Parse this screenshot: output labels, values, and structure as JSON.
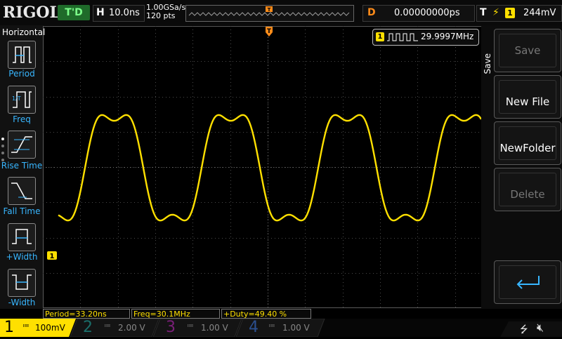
{
  "header": {
    "logo": "RIGOL",
    "run_status": "T'D",
    "timebase_key": "H",
    "timebase_value": "10.0ns",
    "sample_rate": "1.00GSa/s",
    "memory_depth": "120 pts",
    "delay_key": "D",
    "delay_value": "0.00000000ps",
    "trigger_key": "T",
    "trigger_source": "1",
    "trigger_level": "244mV"
  },
  "left_menu": {
    "title": "Horizontal",
    "items": [
      {
        "label": "Period",
        "icon": "period-icon"
      },
      {
        "label": "Freq",
        "icon": "freq-icon"
      },
      {
        "label": "Rise Time",
        "icon": "rise-time-icon"
      },
      {
        "label": "Fall Time",
        "icon": "fall-time-icon"
      },
      {
        "label": "+Width",
        "icon": "positive-width-icon"
      },
      {
        "label": "-Width",
        "icon": "negative-width-icon"
      }
    ]
  },
  "right_menu": {
    "title": "Save",
    "buttons": [
      {
        "label": "Save",
        "enabled": false
      },
      {
        "label": "New File",
        "enabled": true
      },
      {
        "label": "NewFolder",
        "enabled": true
      },
      {
        "label": "Delete",
        "enabled": false
      }
    ],
    "enter_icon": "enter-icon"
  },
  "frequency_counter": {
    "channel": "1",
    "value": "29.9997MHz"
  },
  "measurements": [
    {
      "text": "Period=33.20ns"
    },
    {
      "text": "Freq=30.1MHz"
    },
    {
      "text": "+Duty=49.40 %"
    }
  ],
  "channels": [
    {
      "number": "1",
      "scale": "100mV",
      "color": "#ffe000",
      "active": true
    },
    {
      "number": "2",
      "scale": "2.00 V",
      "color": "#00c2b8",
      "active": false
    },
    {
      "number": "3",
      "scale": "1.00 V",
      "color": "#d000c8",
      "active": false
    },
    {
      "number": "4",
      "scale": "1.00 V",
      "color": "#2d7bff",
      "active": false
    }
  ],
  "status_icons": [
    "usb-icon",
    "mute-icon"
  ],
  "colors": {
    "trace": "#ffe000",
    "accent": "#38b6ff",
    "trigger_marker": "#ff8c1a"
  }
}
